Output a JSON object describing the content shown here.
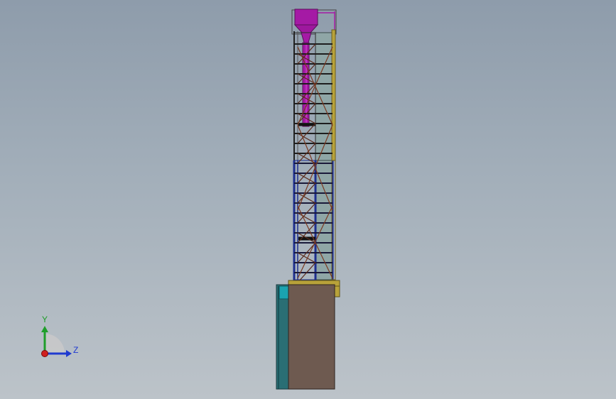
{
  "viewport": {
    "background_top": "#8e9cab",
    "background_bottom": "#bcc3c9"
  },
  "model": {
    "colors": {
      "hopper": "#a51aa5",
      "frame_dark": "#2b2b2b",
      "upper_panel": "#8fa6a6",
      "lower_frame": "#1e2f8f",
      "rail_yellow": "#b8a23a",
      "base_body": "#6e5a50",
      "base_side": "#2a6e74",
      "base_cap": "#1aa3b0",
      "brace": "#7a3a22"
    }
  },
  "triad": {
    "y_label": "Y",
    "z_label": "Z",
    "y_color": "#1f9e2a",
    "z_color": "#1f3ad0",
    "x_color": "#d01f1f"
  }
}
